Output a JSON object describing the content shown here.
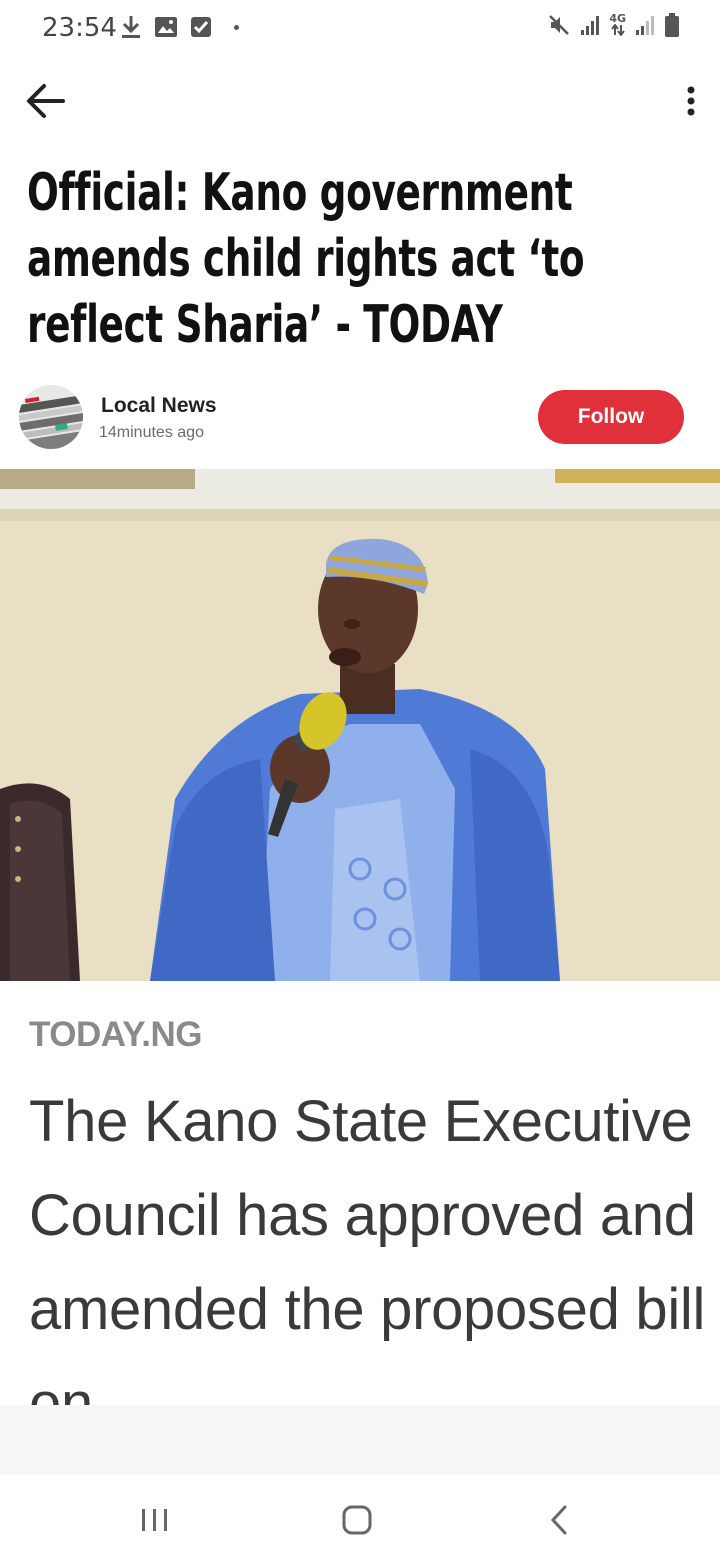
{
  "status_bar": {
    "time": "23:54",
    "network_label": "4G",
    "icons": [
      "download-icon",
      "image-icon",
      "checkbox-icon",
      "notification-dot",
      "mute-icon",
      "signal-icon",
      "4g-data-icon",
      "signal-icon",
      "battery-icon"
    ]
  },
  "app_bar": {
    "back_icon": "arrow-left-icon",
    "menu_icon": "more-vertical-icon"
  },
  "article": {
    "headline": "Official: Kano government amends child rights act ‘to reflect Sharia’ - TODAY",
    "publisher": {
      "name": "Local News",
      "time": "14minutes ago",
      "follow_label": "Follow",
      "follow_color": "#e0303a"
    },
    "source": "TODAY.NG",
    "body": "The Kano State Executive Council has approved and amended the proposed bill on"
  },
  "nav_bar": {
    "recent_icon": "recent-apps-icon",
    "home_icon": "home-icon",
    "back_icon": "nav-back-icon"
  }
}
